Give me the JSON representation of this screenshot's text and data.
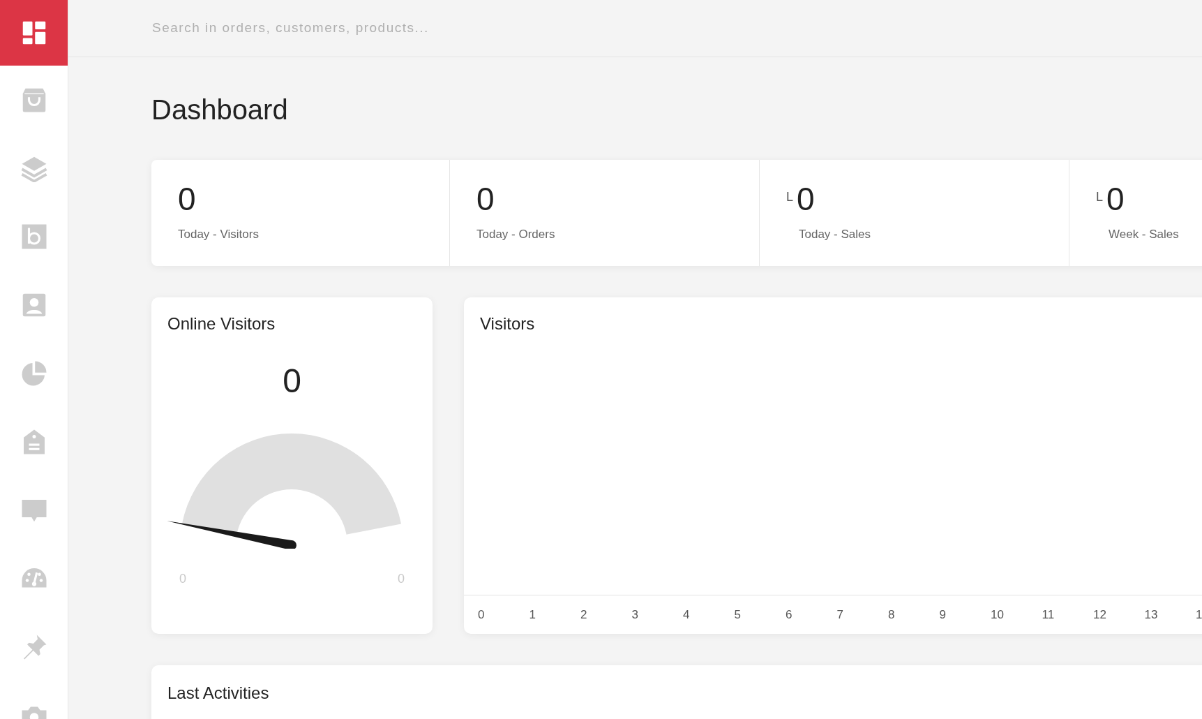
{
  "sidebar": {
    "items": [
      {
        "selected": true
      },
      {
        "selected": false
      },
      {
        "selected": false
      },
      {
        "selected": false
      },
      {
        "selected": false
      },
      {
        "selected": false
      },
      {
        "selected": false
      },
      {
        "selected": false
      },
      {
        "selected": false
      },
      {
        "selected": false
      },
      {
        "selected": false
      }
    ]
  },
  "search": {
    "placeholder": "Search in orders, customers, products..."
  },
  "page_title": "Dashboard",
  "stats": [
    {
      "value": "0",
      "label": "Today - Visitors"
    },
    {
      "value": "0",
      "label": "Today - Orders"
    },
    {
      "prefix": "L",
      "value": "0",
      "label": "Today - Sales"
    },
    {
      "prefix": "L",
      "value": "0",
      "label": "Week - Sales"
    }
  ],
  "online_visitors": {
    "title": "Online Visitors",
    "value": "0",
    "min": "0",
    "max": "0"
  },
  "visitors_chart": {
    "title": "Visitors",
    "x_labels": [
      "0",
      "1",
      "2",
      "3",
      "4",
      "5",
      "6",
      "7",
      "8",
      "9",
      "10",
      "11",
      "12",
      "13",
      "1"
    ]
  },
  "last_activities": {
    "title": "Last Activities"
  }
}
